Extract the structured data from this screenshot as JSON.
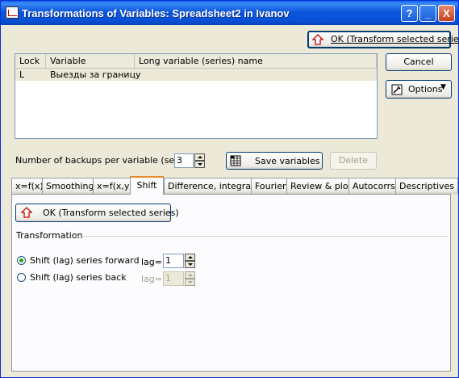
{
  "window": {
    "title": "Transformations of Variables: Spreadsheet2 in Ivanov",
    "help_btn": "?",
    "minimize_btn": "_",
    "close_btn": "X"
  },
  "top_buttons": {
    "ok_transform": "OK (Transform selected series)",
    "cancel": "Cancel",
    "options": "Options"
  },
  "variables_list": {
    "columns": [
      "Lock",
      "Variable",
      "Long variable (series) name"
    ],
    "rows": [
      {
        "lock": "L",
        "variable": "Выезды за границу",
        "long_name": ""
      }
    ]
  },
  "backups": {
    "label": "Number of backups per variable (series):",
    "value": "3",
    "save_button": "Save variables",
    "delete_button": "Delete"
  },
  "tabs": [
    "x=f(x)",
    "Smoothing",
    "x=f(x,y)",
    "Shift",
    "Difference, integrate",
    "Fourier",
    "Review & plot",
    "Autocorrs",
    "Descriptives"
  ],
  "active_tab": "Shift",
  "shift_panel": {
    "ok_button": "OK (Transform selected series)",
    "group_label": "Transformation",
    "option_forward": "Shift (lag) series forward",
    "option_back": "Shift (lag) series back",
    "lag_label": "lag=",
    "lag_forward_value": "1",
    "lag_back_value": "1",
    "selected_option": "forward"
  }
}
